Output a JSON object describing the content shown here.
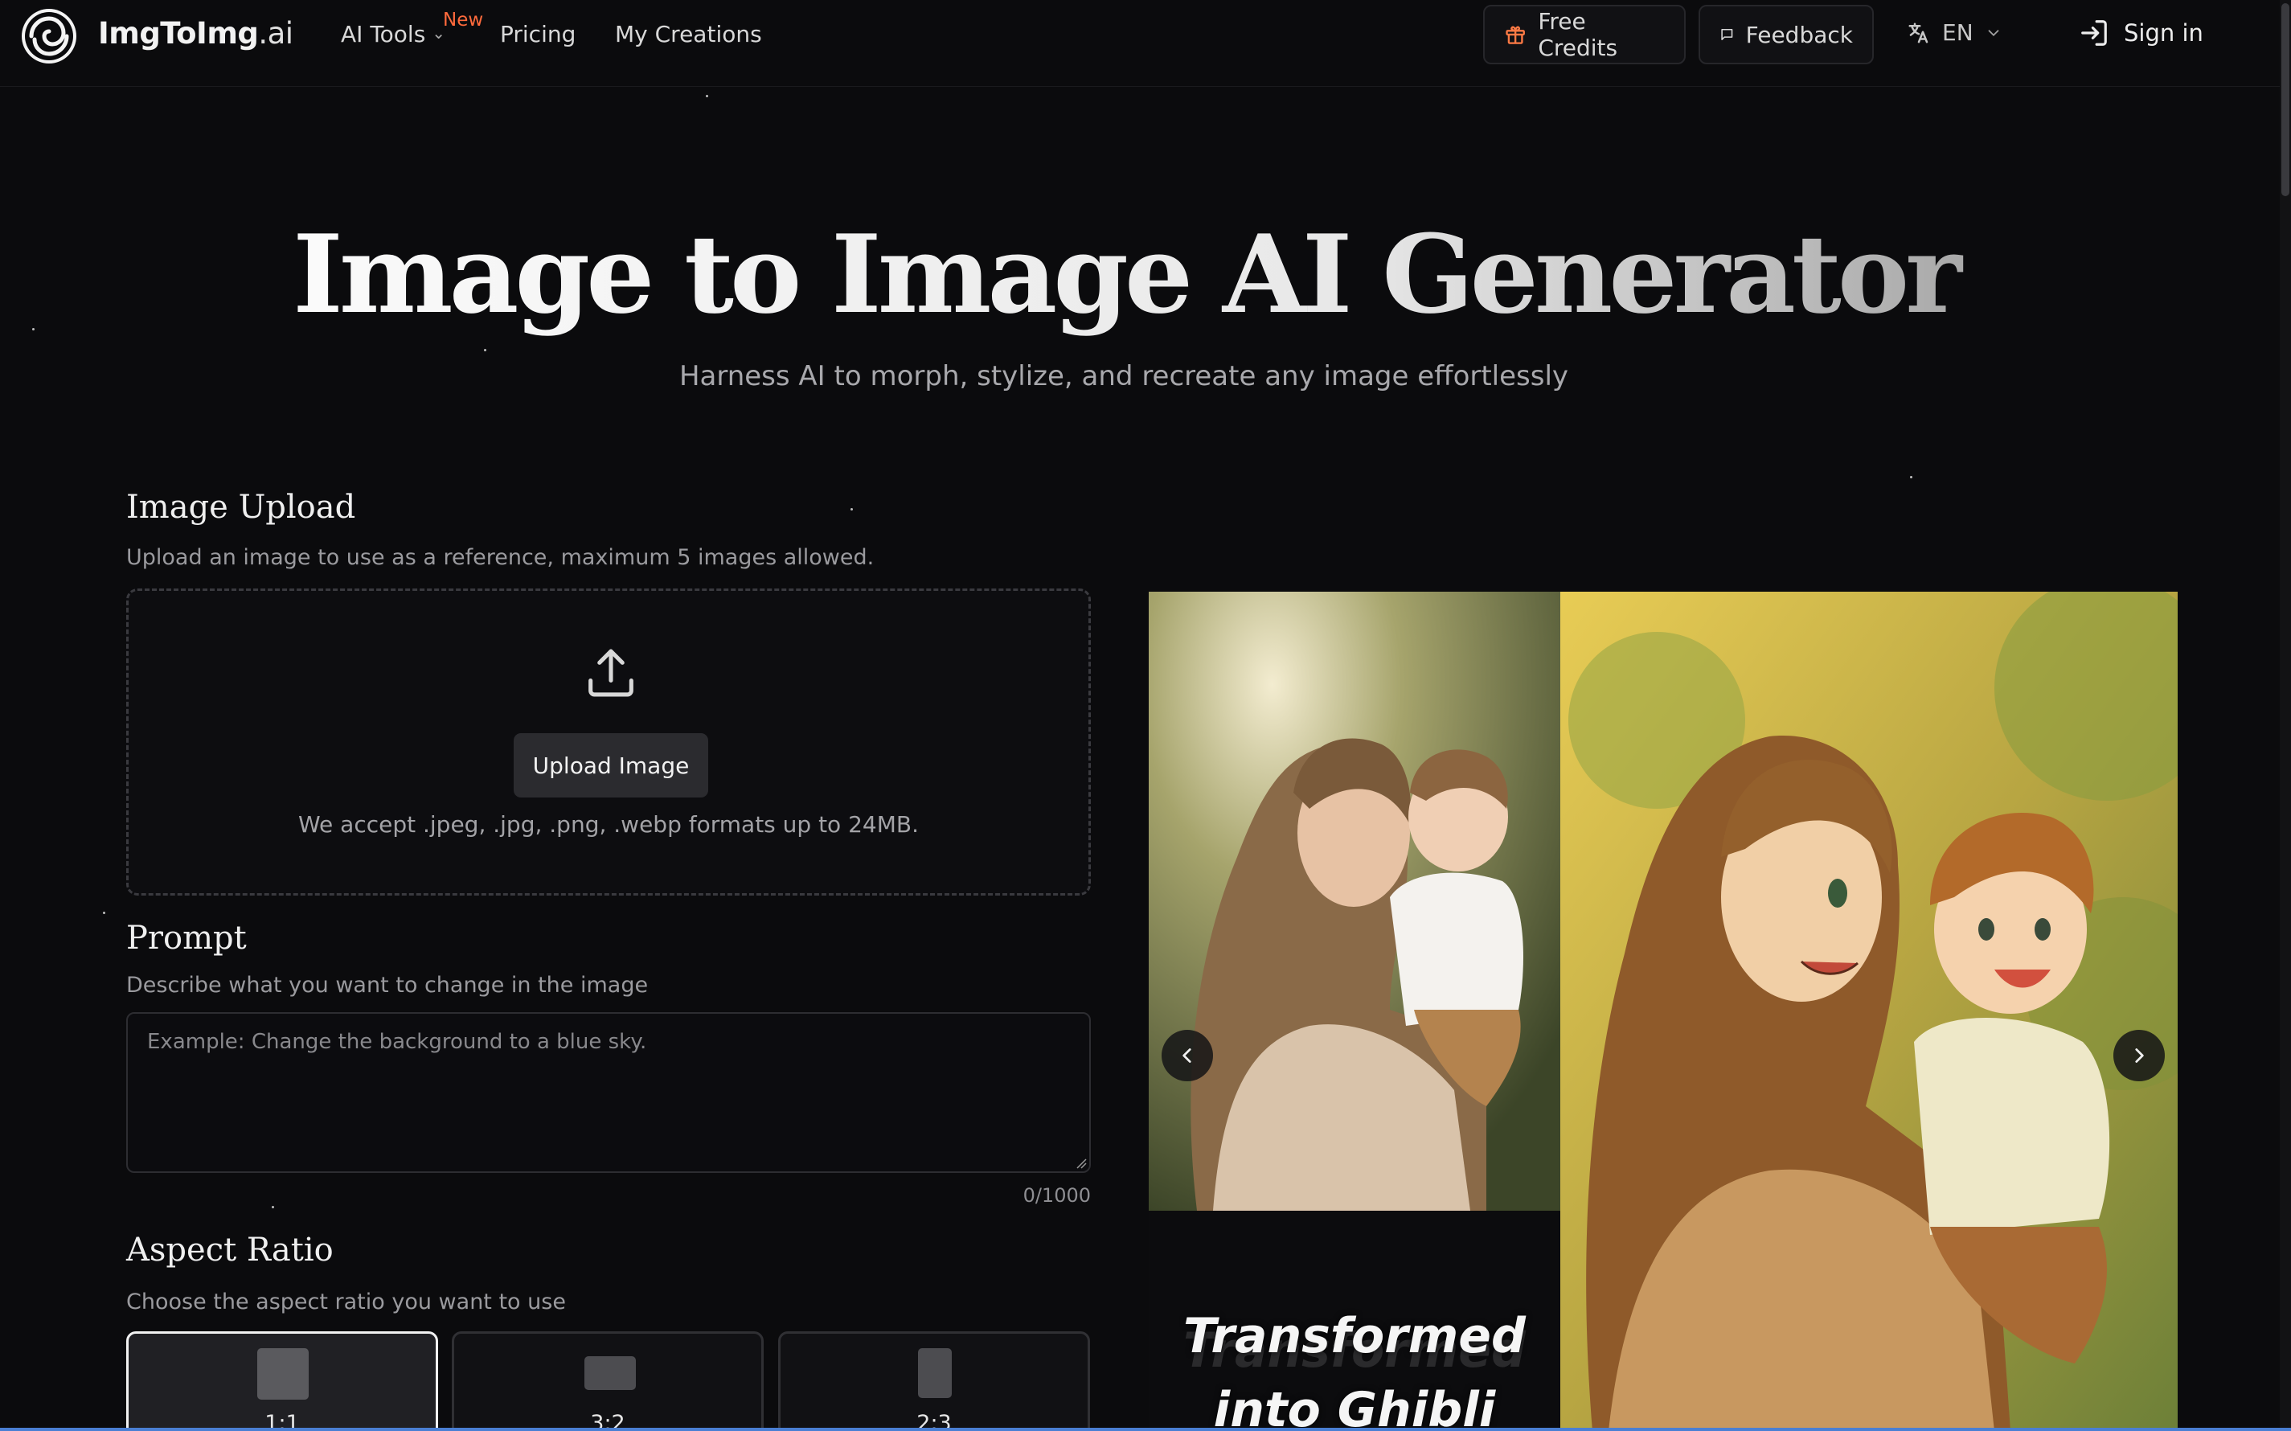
{
  "header": {
    "brand_main": "ImgToImg",
    "brand_suffix": ".ai",
    "nav": {
      "ai_tools": "AI Tools",
      "new_badge": "New",
      "pricing": "Pricing",
      "my_creations": "My Creations"
    },
    "free_credits": "Free Credits",
    "feedback": "Feedback",
    "language": "EN",
    "sign_in": "Sign in"
  },
  "hero": {
    "title": "Image to Image AI Generator",
    "subtitle": "Harness AI to morph, stylize, and recreate any image effortlessly"
  },
  "upload": {
    "title": "Image Upload",
    "description": "Upload an image to use as a reference, maximum 5 images allowed.",
    "button": "Upload Image",
    "note": "We accept .jpeg, .jpg, .png, .webp formats up to 24MB."
  },
  "prompt": {
    "title": "Prompt",
    "description": "Describe what you want to change in the image",
    "placeholder": "Example: Change the background to a blue sky.",
    "value": "",
    "counter": "0/1000"
  },
  "aspect_ratio": {
    "title": "Aspect Ratio",
    "description": "Choose the aspect ratio you want to use",
    "options": [
      {
        "label": "1:1",
        "selected": true
      },
      {
        "label": "3:2",
        "selected": false
      },
      {
        "label": "2:3",
        "selected": false
      }
    ]
  },
  "showcase": {
    "caption": "Transformed into Ghibli",
    "caption_line1": "Transformed",
    "caption_line2": "into Ghibli"
  },
  "colors": {
    "accent_new": "#ff6a3c",
    "background": "#0b0b0d",
    "gift_icon": "#ff7a45"
  },
  "icons": {
    "logo": "spiral-logo-icon",
    "ai_tools_chevron": "chevron-down-icon",
    "free_credits": "gift-icon",
    "feedback": "message-square-icon",
    "language": "translate-icon",
    "language_chevron": "chevron-down-icon",
    "sign_in": "log-in-icon",
    "upload": "upload-icon",
    "carousel_prev": "chevron-left-icon",
    "carousel_next": "chevron-right-icon"
  }
}
